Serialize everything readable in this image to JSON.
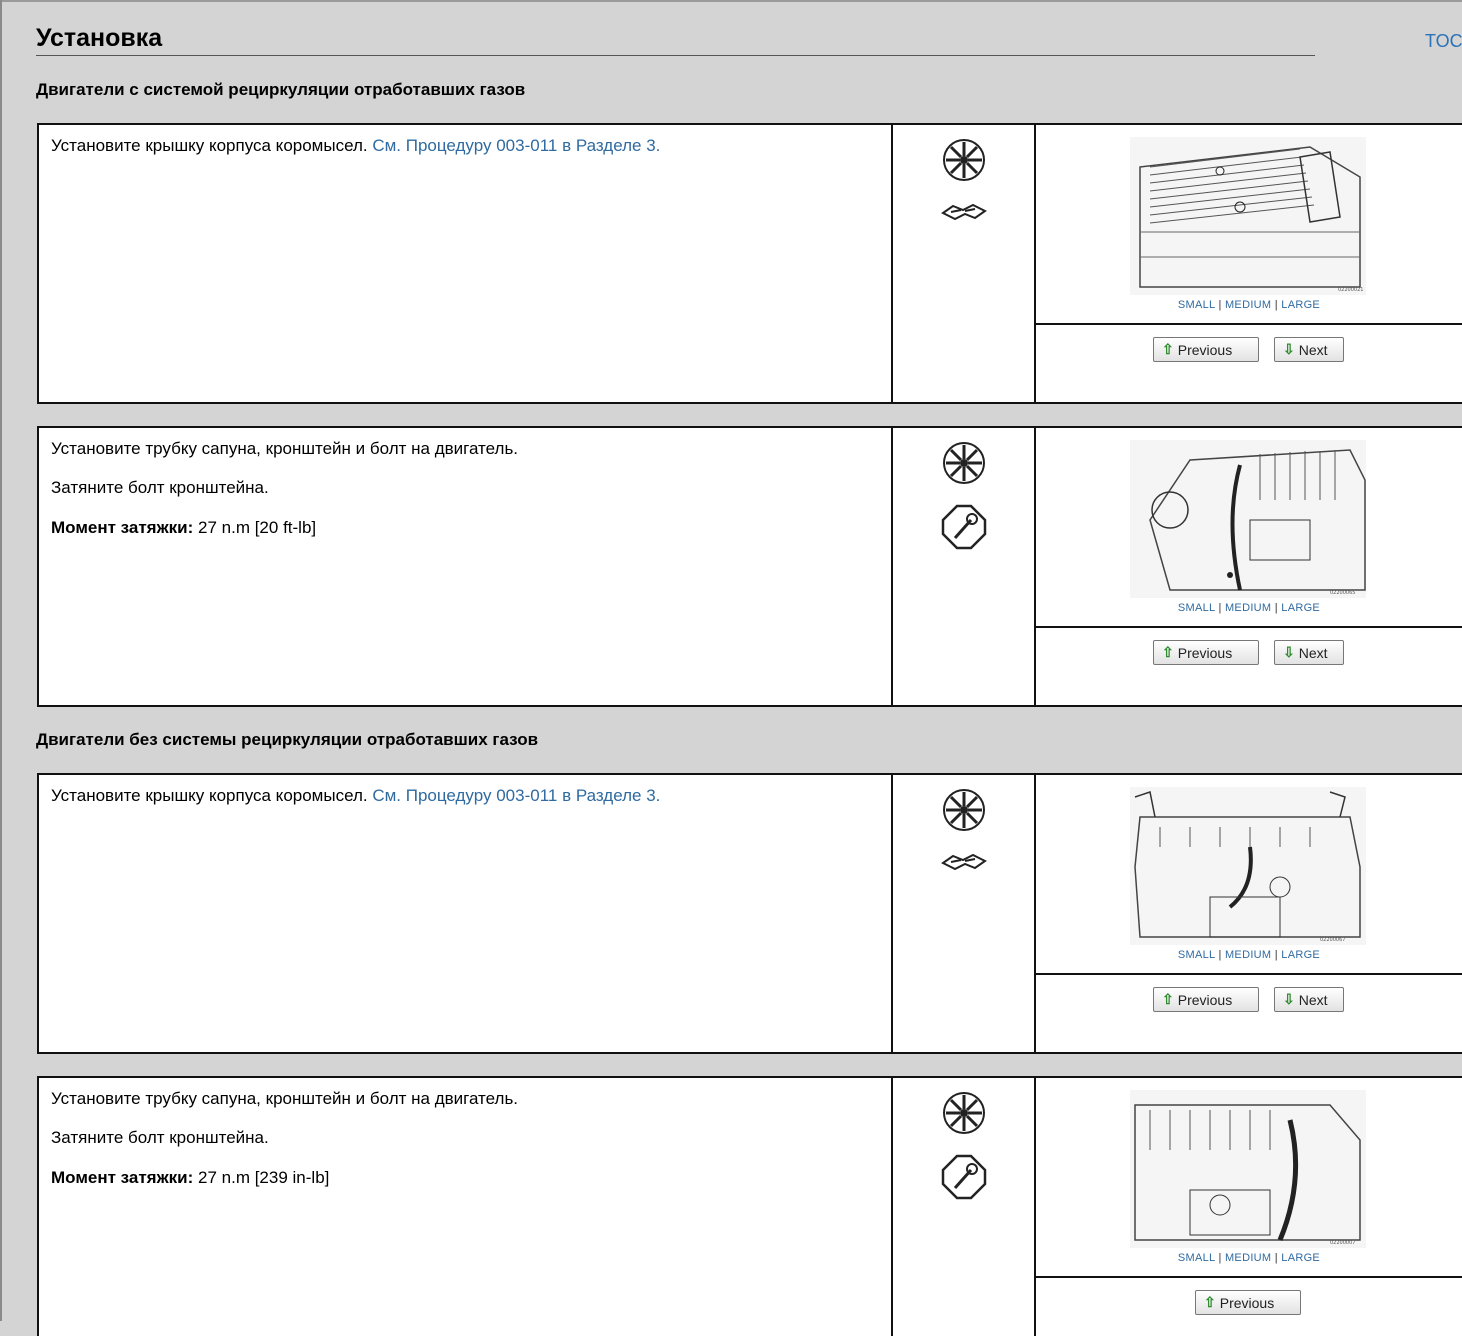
{
  "page": {
    "title": "Установка",
    "toc_label": "TOC"
  },
  "sections": [
    {
      "heading": "Двигатели с системой рециркуляции отработавших газов"
    },
    {
      "heading": "Двигатели без системы рециркуляции отработавших газов"
    }
  ],
  "figure_sizes": {
    "small": "SMALL",
    "medium": "MEDIUM",
    "large": "LARGE",
    "separator": "|"
  },
  "nav": {
    "previous": "Previous",
    "next": "Next"
  },
  "steps": [
    {
      "text": "Установите крышку корпуса коромысел. ",
      "link": "См. Процедуру 003-011 в Разделе 3.",
      "icons": [
        "parts-wheel-icon",
        "gasket-icon"
      ],
      "figure_code": "02200021"
    },
    {
      "text": "Установите трубку сапуна, кронштейн и болт на двигатель.",
      "text2": "Затяните болт кронштейна.",
      "torque_label": "Момент затяжки:",
      "torque_value": "27  n.m  [20 ft-lb]",
      "icons": [
        "parts-wheel-icon",
        "torque-wrench-icon"
      ],
      "figure_code": "02200065"
    },
    {
      "text": "Установите крышку корпуса коромысел. ",
      "link": "См. Процедуру 003-011 в Разделе 3.",
      "icons": [
        "parts-wheel-icon",
        "gasket-icon"
      ],
      "figure_code": "02200067"
    },
    {
      "text": "Установите трубку сапуна, кронштейн и болт на двигатель.",
      "text2": "Затяните болт кронштейна.",
      "torque_label": "Момент затяжки:",
      "torque_value": "27  n.m  [239 in-lb]",
      "icons": [
        "parts-wheel-icon",
        "torque-wrench-icon"
      ],
      "figure_code": "02200007"
    }
  ]
}
